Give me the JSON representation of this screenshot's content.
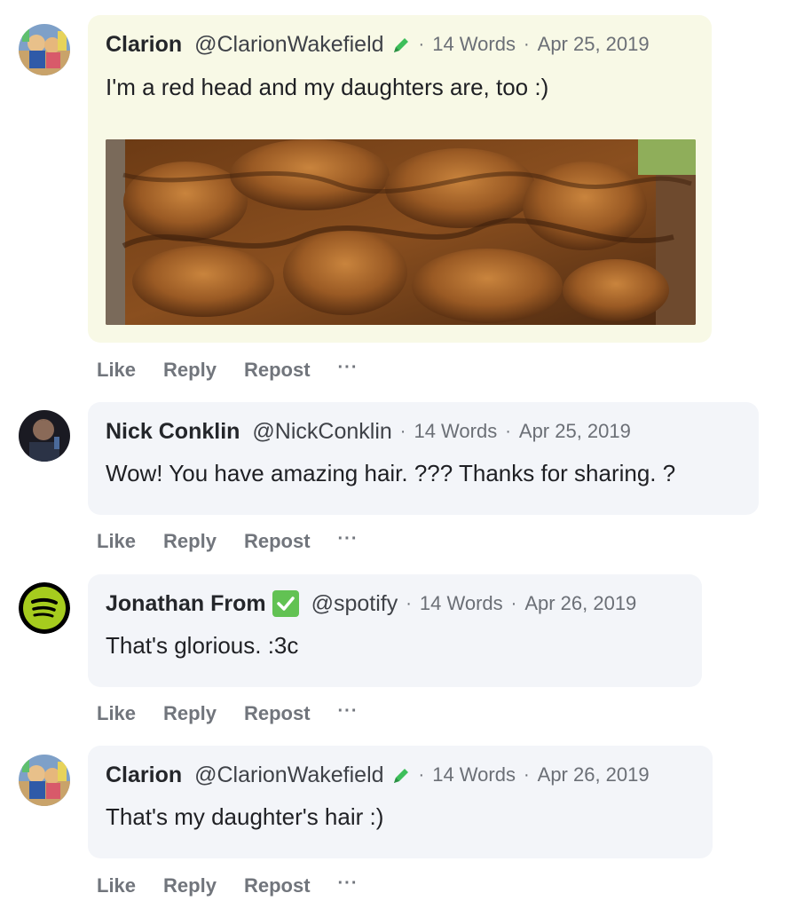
{
  "comments": [
    {
      "author": "Clarion",
      "handle": "@ClarionWakefield",
      "words": "14 Words",
      "date": "Apr 25, 2019",
      "text": "I'm a red head and my daughters are, too :)",
      "highlight": true,
      "badge": "pencil-icon",
      "has_image": true,
      "avatar": "clarion-avatar"
    },
    {
      "author": "Nick Conklin",
      "handle": "@NickConklin",
      "words": "14 Words",
      "date": "Apr 25, 2019",
      "text": "Wow! You have amazing hair. ??? Thanks for sharing. ?",
      "highlight": false,
      "avatar": "nick-avatar"
    },
    {
      "author": "Jonathan From",
      "handle": "@spotify",
      "words": "14 Words",
      "date": "Apr 26, 2019",
      "text": "That's glorious. :3c",
      "highlight": false,
      "badge": "verified-check-icon",
      "avatar": "spotify-avatar"
    },
    {
      "author": "Clarion",
      "handle": "@ClarionWakefield",
      "words": "14 Words",
      "date": "Apr 26, 2019",
      "text": "That's my daughter's hair :)",
      "highlight": false,
      "badge": "pencil-icon",
      "avatar": "clarion-avatar"
    }
  ],
  "actions": {
    "like": "Like",
    "reply": "Reply",
    "repost": "Repost",
    "more": "···"
  },
  "colors": {
    "highlight_bg": "#f8f9e6",
    "bubble_bg": "#f3f5f9",
    "pencil": "#3dbf5a",
    "verified": "#62c253",
    "spotify_green": "#a6cc1e"
  }
}
